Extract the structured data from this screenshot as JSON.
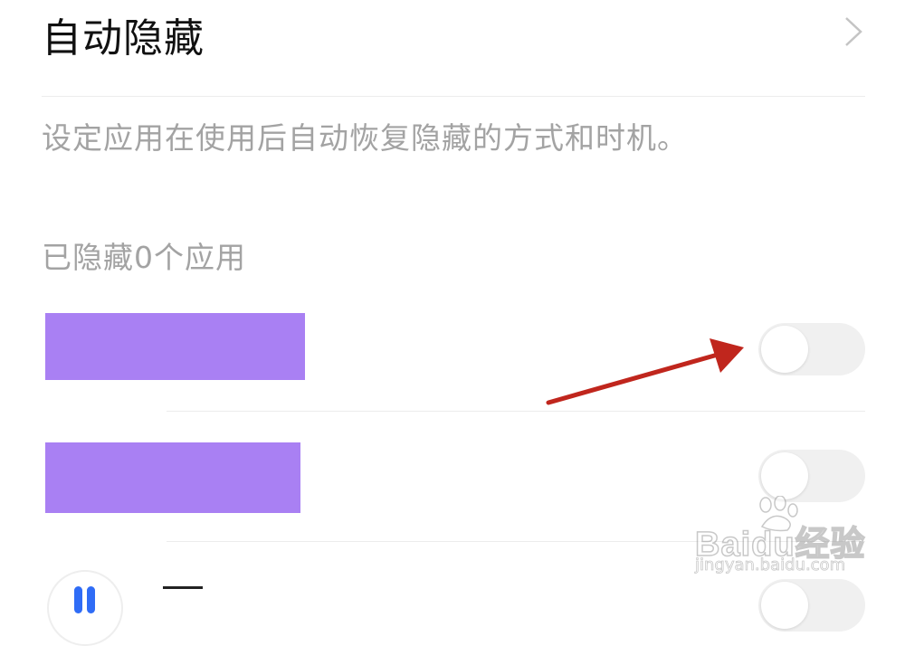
{
  "auto_hide": {
    "title": "自动隐藏"
  },
  "description": "设定应用在使用后自动恢复隐藏的方式和时机。",
  "hidden_section": {
    "header": "已隐藏0个应用"
  },
  "apps": [
    {
      "name": "",
      "redacted": true,
      "toggle_on": false
    },
    {
      "name": "",
      "redacted": true,
      "toggle_on": false
    },
    {
      "name": "",
      "toggle_on": false
    }
  ],
  "annotation": {
    "color": "#c0261d"
  },
  "watermark": {
    "brand": "Baidu经验",
    "sub": "jingyan.baidu.com"
  },
  "colors": {
    "redaction": "#a980f3",
    "toggle_off": "#f0f0f0"
  }
}
